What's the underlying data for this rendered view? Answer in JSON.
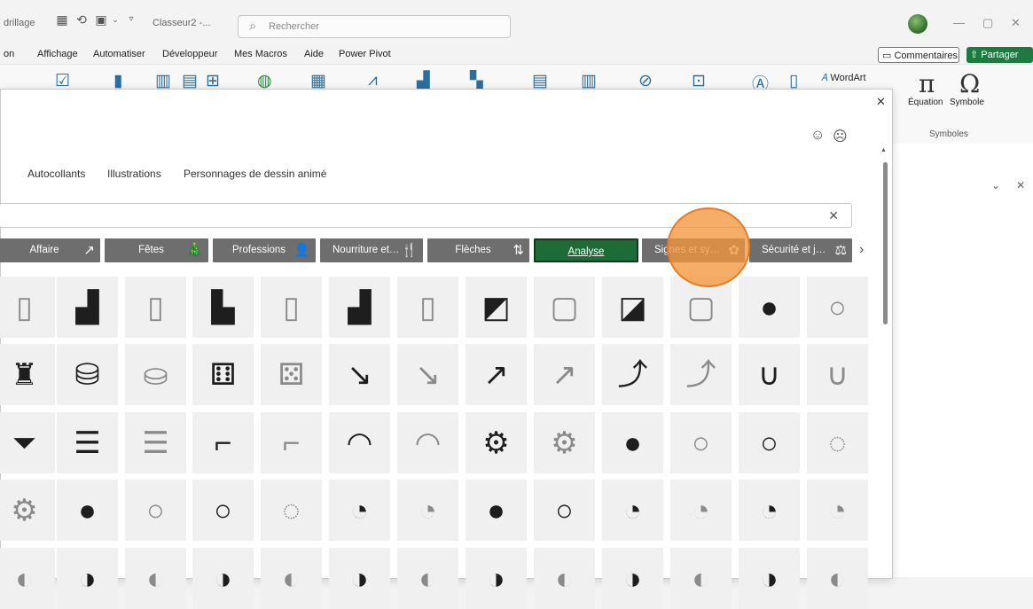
{
  "titlebar": {
    "left_text": "drillage",
    "workbook": "Classeur2 -...",
    "search_placeholder": "Rechercher"
  },
  "menu": [
    "on",
    "Affichage",
    "Automatiser",
    "Développeur",
    "Mes Macros",
    "Aide",
    "Power Pivot"
  ],
  "comments_label": "Commentaires",
  "share_label": "Partager",
  "ribbon": {
    "wordart": "WordArt",
    "equation": "Équation",
    "symbol": "Symbole",
    "group": "Symboles"
  },
  "tabs": [
    "Autocollants",
    "Illustrations",
    "Personnages de dessin animé"
  ],
  "categories": [
    {
      "label": "Affaire",
      "icon": "↗"
    },
    {
      "label": "Fêtes",
      "icon": "🎄"
    },
    {
      "label": "Professions",
      "icon": "👤"
    },
    {
      "label": "Nourriture et b...",
      "icon": "🍴"
    },
    {
      "label": "Flèches",
      "icon": "⇅"
    },
    {
      "label": "Analyse",
      "icon": ""
    },
    {
      "label": "Signes et symb...",
      "icon": "✿"
    },
    {
      "label": "Sécurité et just...",
      "icon": "⚖"
    }
  ],
  "icon_grid": [
    [
      "bar-chart-outline-icon",
      "bar-chart-icon",
      "bar-chart-outline-icon",
      "bar-chart-decrease-icon",
      "bar-chart-decrease-outline-icon",
      "bar-chart-increase-icon",
      "bar-chart-increase-outline-icon",
      "bar-chart-increase-frame-icon",
      "bar-chart-increase-frame-outline-icon",
      "bar-chart-decrease-frame-icon",
      "bar-chart-decrease-frame-outline-icon",
      "head-lightbulb-icon",
      "head-lightbulb-outline-icon"
    ],
    [
      "chess-icon",
      "database-icon",
      "database-outline-icon",
      "dice-icon",
      "dice-outline-icon",
      "line-chart-decrease-icon",
      "line-chart-decrease-outline-icon",
      "line-chart-increase-icon",
      "line-chart-increase-outline-icon",
      "exponential-graph-icon",
      "exponential-graph-outline-icon",
      "u-curve-icon",
      "u-curve-outline-icon"
    ],
    [
      "funnel-icon",
      "gantt-chart-icon",
      "gantt-chart-outline-icon",
      "stairs-chart-icon",
      "stairs-chart-outline-icon",
      "gauge-icon",
      "gauge-outline-icon",
      "gears-icon",
      "gears-outline-icon",
      "head-lightbulb-icon",
      "head-lightbulb-outline-icon",
      "circle-icon",
      "circle-dotted-icon"
    ],
    [
      "gears-outline-icon",
      "head-lightbulb-icon",
      "head-lightbulb-outline-icon",
      "circle-icon",
      "circle-dotted-icon",
      "pie-quarter-icon",
      "pie-quarter-outline-icon",
      "circle-filled-icon",
      "circle-icon",
      "pie-quarter-icon",
      "pie-quarter-outline-icon",
      "pie-quarter-icon",
      "pie-quarter-outline-icon"
    ],
    [
      "pie-half-outline-icon",
      "pie-half-icon",
      "pie-half-outline-icon",
      "pie-half-icon",
      "pie-half-outline-icon",
      "pie-half-icon",
      "pie-half-outline-icon",
      "pie-half-icon",
      "pie-half-outline-icon",
      "pie-half-icon",
      "pie-half-outline-icon",
      "pie-half-icon",
      "pie-half-outline-icon"
    ]
  ]
}
